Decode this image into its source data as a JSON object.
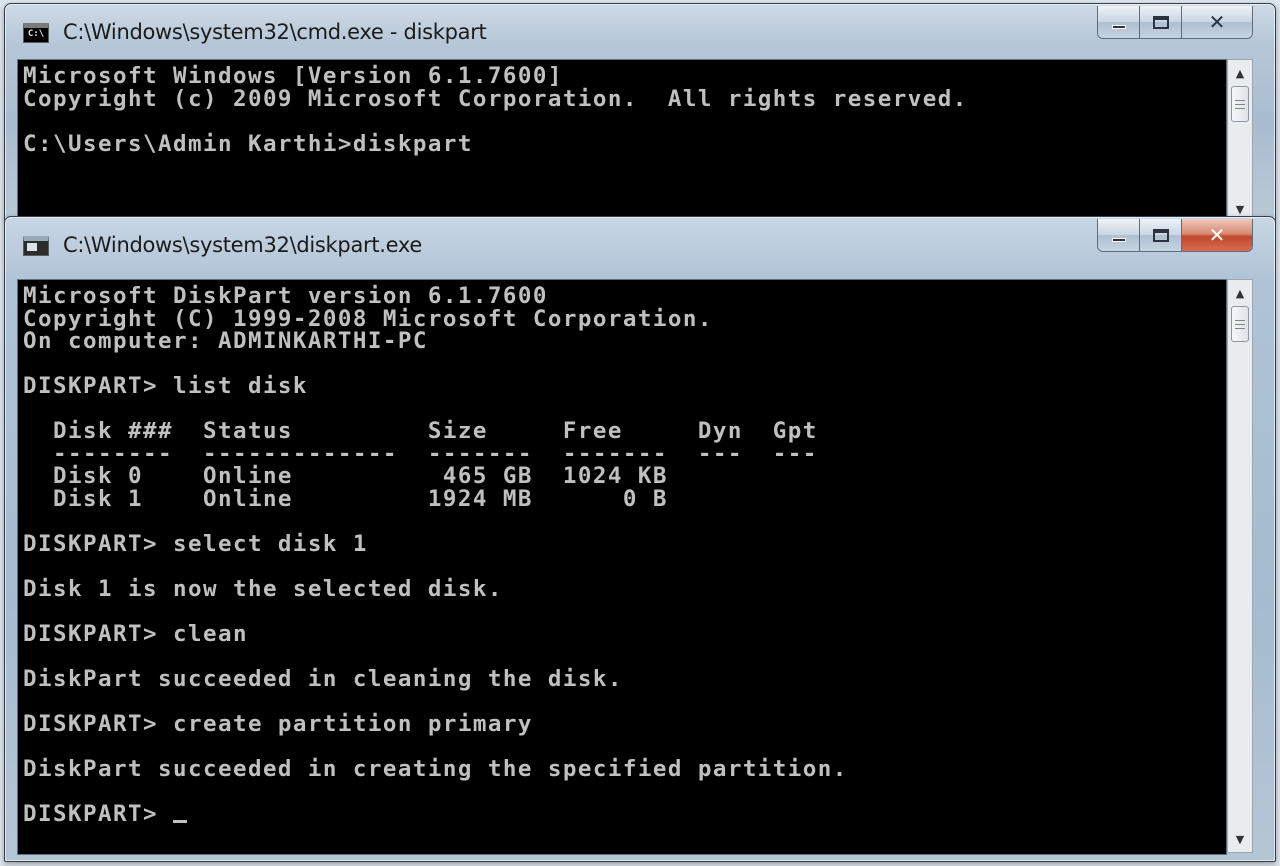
{
  "cmd_window": {
    "title": "C:\\Windows\\system32\\cmd.exe - diskpart",
    "icon": "cmd-icon",
    "icon_text": "C:\\",
    "lines": [
      "Microsoft Windows [Version 6.1.7600]",
      "Copyright (c) 2009 Microsoft Corporation.  All rights reserved.",
      "",
      "C:\\Users\\Admin Karthi>diskpart"
    ]
  },
  "diskpart_window": {
    "title": "C:\\Windows\\system32\\diskpart.exe",
    "icon": "console-window-icon",
    "lines": [
      "Microsoft DiskPart version 6.1.7600",
      "Copyright (C) 1999-2008 Microsoft Corporation.",
      "On computer: ADMINKARTHI-PC",
      "",
      "DISKPART> list disk",
      "",
      "  Disk ###  Status         Size     Free     Dyn  Gpt",
      "  --------  -------------  -------  -------  ---  ---",
      "  Disk 0    Online          465 GB  1024 KB",
      "  Disk 1    Online         1924 MB      0 B",
      "",
      "DISKPART> select disk 1",
      "",
      "Disk 1 is now the selected disk.",
      "",
      "DISKPART> clean",
      "",
      "DiskPart succeeded in cleaning the disk.",
      "",
      "DISKPART> create partition primary",
      "",
      "DiskPart succeeded in creating the specified partition.",
      ""
    ],
    "prompt": "DISKPART> "
  },
  "caption_buttons": {
    "minimize": "minimize",
    "maximize": "maximize",
    "close": "✕"
  }
}
